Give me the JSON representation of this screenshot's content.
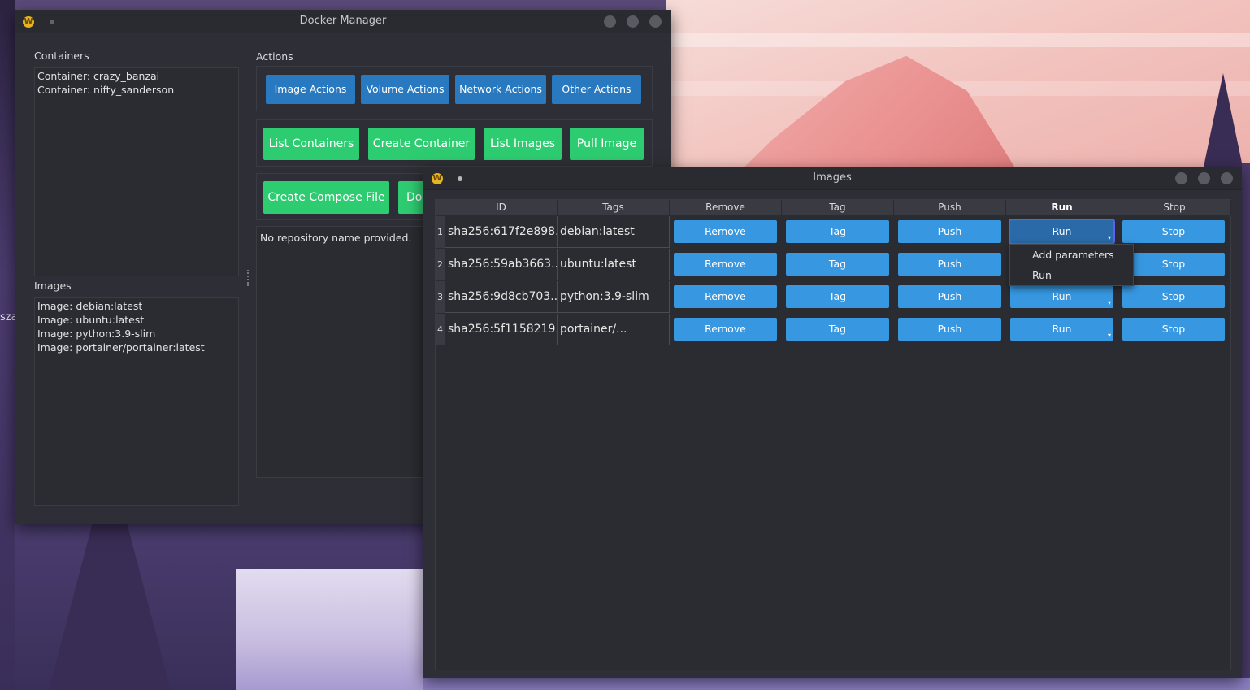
{
  "desktop": {
    "partial_label": "sza"
  },
  "main_window": {
    "title": "Docker Manager",
    "containers_label": "Containers",
    "containers": [
      "Container: crazy_banzai",
      "Container: nifty_sanderson"
    ],
    "images_label": "Images",
    "images": [
      "Image: debian:latest",
      "Image: ubuntu:latest",
      "Image: python:3.9-slim",
      "Image: portainer/portainer:latest"
    ],
    "actions_label": "Actions",
    "action_tabs": [
      "Image Actions",
      "Volume Actions",
      "Network Actions",
      "Other Actions"
    ],
    "green_buttons_row1": [
      "List Containers",
      "Create Container",
      "List Images",
      "Pull Image"
    ],
    "green_buttons_row2": [
      "Create Compose File",
      "Do"
    ],
    "output_text": "No repository name provided."
  },
  "images_window": {
    "title": "Images",
    "columns": [
      "ID",
      "Tags",
      "Remove",
      "Tag",
      "Push",
      "Run",
      "Stop"
    ],
    "rows": [
      {
        "num": "1",
        "id": "sha256:617f2e898...",
        "tags": "debian:latest"
      },
      {
        "num": "2",
        "id": "sha256:59ab3663...",
        "tags": "ubuntu:latest"
      },
      {
        "num": "3",
        "id": "sha256:9d8cb703...",
        "tags": "python:3.9-slim"
      },
      {
        "num": "4",
        "id": "sha256:5f1158219...",
        "tags": "portainer/..."
      }
    ],
    "button_labels": {
      "remove": "Remove",
      "tag": "Tag",
      "push": "Push",
      "run": "Run",
      "stop": "Stop"
    },
    "run_menu": [
      "Add parameters",
      "Run"
    ]
  },
  "colors": {
    "window_bg": "#2e2f36",
    "action_tab_blue": "#2879bf",
    "green_button": "#2ecc71",
    "table_button_blue": "#3797e0"
  }
}
